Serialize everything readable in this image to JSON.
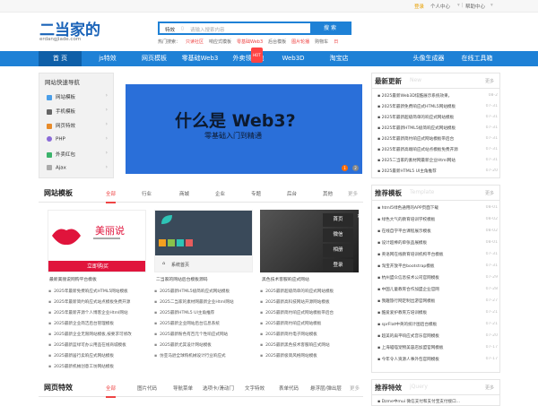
{
  "topbar": {
    "login": "登录",
    "user_center": "个人中心",
    "help_center": "帮助中心"
  },
  "logo": {
    "name": "二当家的",
    "domain": "erdangjiade.com"
  },
  "search": {
    "type": "特效",
    "placeholder": "请输入搜索内容",
    "button": "搜 索"
  },
  "hot_search": {
    "label": "热门搜索：",
    "items": [
      "只读社区",
      "响应式模板",
      "零基础Web3",
      "后台模板",
      "图片轮播",
      "购物车",
      "日"
    ]
  },
  "nav": {
    "items": [
      "首 页",
      "js特效",
      "网页模板",
      "零基础Web3",
      "外卖领红包",
      "Web3D",
      "淘宝店",
      "头像生成器",
      "在线工具箱"
    ],
    "badge": "HOT"
  },
  "quick_nav": {
    "title": "网站快速导航",
    "items": [
      "网站模板",
      "手机模板",
      "网页特效",
      "PHP",
      "外卖红包",
      "Ajax"
    ]
  },
  "banner": {
    "headline": "什么是 Web3?",
    "subline": "零基础入门到精通",
    "dots": [
      "1",
      "2"
    ]
  },
  "latest": {
    "title": "最新更新",
    "en": "New",
    "more": "更多",
    "items": [
      {
        "t": "2025最新Web3D炫酷展示系统效果，",
        "d": "08-2"
      },
      {
        "t": "2025年最新免费响应式HTML5网站模板",
        "d": "07-31"
      },
      {
        "t": "2025年最新超级简单的响应式网站模板",
        "d": "07-31"
      },
      {
        "t": "2025年最新HTML5极简响应式网站模板",
        "d": "07-31"
      },
      {
        "t": "2025年最新简约响应式网站模板带后台",
        "d": "07-31"
      },
      {
        "t": "2025年最新高端响应式站点模板免费开源",
        "d": "07-31"
      },
      {
        "t": "2025二当家的素材网最新企业Html网站",
        "d": "07-31"
      },
      {
        "t": "2025最新HTML5 UI主角推荐",
        "d": "07-20"
      }
    ]
  },
  "templates": {
    "title": "网站模板",
    "tabs": [
      "全部",
      "行业",
      "商城",
      "企业",
      "专题",
      "后台",
      "其他"
    ],
    "more": "更多",
    "cards": [
      {
        "brand": "美丽说",
        "btn": "立即购买",
        "caption": "最新美丽说网购平台模板"
      },
      {
        "menu": "系统首页",
        "caption": "二当家的网站后台模板源码"
      },
      {
        "caption": "黑色技术客服响应式网站",
        "menu_items": [
          "首页",
          "微信",
          "相册",
          "登录"
        ]
      }
    ],
    "col1": [
      "2025年最新免费响应式HTML5网站模板",
      "2025年最新简约响应式站点模板免费开源",
      "2025年最新开源个人博客企业Html网站",
      "2025最新企业简洁后台管理模板",
      "2025最新企业无限网站模板,按要求可修改",
      "2025最新蓝绿可办公用品在线商城模板",
      "2025最新居行卖响应式网站模板",
      "2025最新机械创意工坊网站模板"
    ],
    "col2": [
      "2025最新HTML5极简响应式网站模板",
      "2025二当家的素材网最新企业Html网站",
      "2025最新HTML5 UI主角推荐",
      "2025最新企业网站后台信息系统",
      "2025最新粉色有百元个性响应式网站",
      "2025最新尤其设计网站模板",
      "仿亚马逊全球购机械设计行业响应式"
    ],
    "col3": [
      "2025最新超级简单的响应式网站模板",
      "2025最新高科技网站开源网站模板",
      "2025最新简约响应式网站模板带后台",
      "2025最新简约响应式网站模板",
      "2025最新简约电子网站模板",
      "2025最新黑色技术客服响应式网站",
      "2025最新极简风格网站模板"
    ]
  },
  "recommend": {
    "title": "推荐模板",
    "en": "Template",
    "more": "更多",
    "items": [
      {
        "t": "html5绿色通用的APP页面下载",
        "d": "08-01"
      },
      {
        "t": "绿色大气的教育培训学校模板",
        "d": "08-02"
      },
      {
        "t": "在线自学平台课程展示模板",
        "d": "08-02"
      },
      {
        "t": "设计超棒的单张品展模板",
        "d": "08-01"
      },
      {
        "t": "英语网在线教育培训机构平台模板",
        "d": "07-31"
      },
      {
        "t": "淘宝开放平台bootstrap模板",
        "d": "07-31"
      },
      {
        "t": "杭州盟众信息技术公司官网模板",
        "d": "07-29"
      },
      {
        "t": "中国儿童教育合作加盟企业官网",
        "d": "07-28"
      },
      {
        "t": "我趣旅行网定制出游官网模板",
        "d": "07-27"
      },
      {
        "t": "酷爱爱护教育方培训模板",
        "d": "07-21"
      },
      {
        "t": "sprFlat中英的统计图后台模板",
        "d": "07-21"
      },
      {
        "t": "超美的扁平响应式音乐官网模板",
        "d": "07-20"
      },
      {
        "t": "上海喵喵宠物美容店加盟官网模板",
        "d": "07-17"
      },
      {
        "t": "今年令人资源人事外包官网模板",
        "d": "07-17"
      }
    ]
  },
  "effects": {
    "title": "网页特效",
    "tabs": [
      "全部",
      "图片代码",
      "导航菜单",
      "选项卡/滑动门",
      "文字特效",
      "表单代码",
      "悬浮层/弹出层"
    ],
    "more": "更多"
  },
  "recommend_fx": {
    "title": "推荐特效",
    "en": "jQuery",
    "more": "更多",
    "first": "Dzme中mui 微信支付和支付宝支付接口..."
  },
  "colors": {
    "brand": "#1e81d6",
    "accent": "#e44"
  }
}
